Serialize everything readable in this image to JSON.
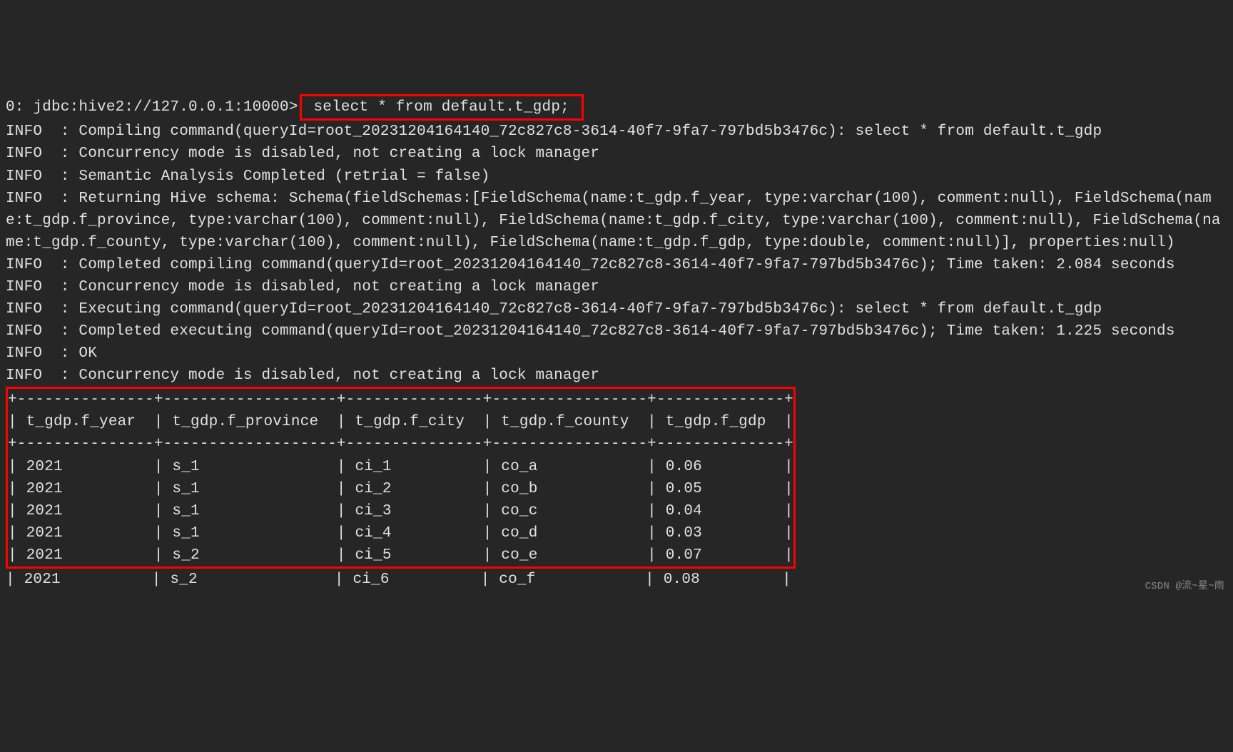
{
  "prompt": {
    "prefix": "0: jdbc:hive2://127.0.0.1:10000>",
    "command": " select * from default.t_gdp; "
  },
  "log_lines": [
    "INFO  : Compiling command(queryId=root_20231204164140_72c827c8-3614-40f7-9fa7-797bd5b3476c): select * from default.t_gdp",
    "INFO  : Concurrency mode is disabled, not creating a lock manager",
    "INFO  : Semantic Analysis Completed (retrial = false)",
    "INFO  : Returning Hive schema: Schema(fieldSchemas:[FieldSchema(name:t_gdp.f_year, type:varchar(100), comment:null), FieldSchema(name:t_gdp.f_province, type:varchar(100), comment:null), FieldSchema(name:t_gdp.f_city, type:varchar(100), comment:null), FieldSchema(name:t_gdp.f_county, type:varchar(100), comment:null), FieldSchema(name:t_gdp.f_gdp, type:double, comment:null)], properties:null)",
    "INFO  : Completed compiling command(queryId=root_20231204164140_72c827c8-3614-40f7-9fa7-797bd5b3476c); Time taken: 2.084 seconds",
    "INFO  : Concurrency mode is disabled, not creating a lock manager",
    "INFO  : Executing command(queryId=root_20231204164140_72c827c8-3614-40f7-9fa7-797bd5b3476c): select * from default.t_gdp",
    "INFO  : Completed executing command(queryId=root_20231204164140_72c827c8-3614-40f7-9fa7-797bd5b3476c); Time taken: 1.225 seconds",
    "INFO  : OK",
    "INFO  : Concurrency mode is disabled, not creating a lock manager"
  ],
  "table": {
    "divider": "+---------------+-------------------+---------------+-----------------+--------------+",
    "header": "| t_gdp.f_year  | t_gdp.f_province  | t_gdp.f_city  | t_gdp.f_county  | t_gdp.f_gdp  |",
    "rows": [
      "| 2021          | s_1               | ci_1          | co_a            | 0.06         |",
      "| 2021          | s_1               | ci_2          | co_b            | 0.05         |",
      "| 2021          | s_1               | ci_3          | co_c            | 0.04         |",
      "| 2021          | s_1               | ci_4          | co_d            | 0.03         |",
      "| 2021          | s_2               | ci_5          | co_e            | 0.07         |"
    ],
    "trailing": "| 2021          | s_2               | ci_6          | co_f            | 0.08         |"
  },
  "watermark": "CSDN @流~星~雨"
}
